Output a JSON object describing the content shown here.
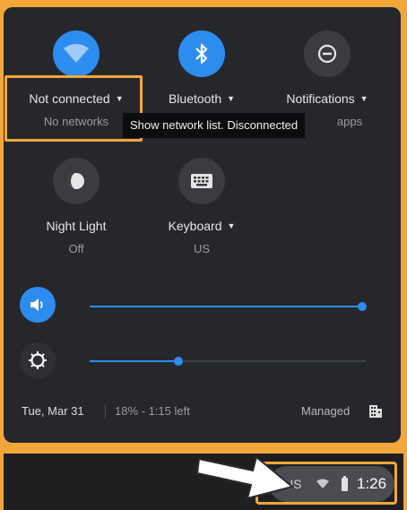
{
  "tiles": [
    {
      "label": "Not connected",
      "sub": "No networks",
      "icon": "wifi-icon",
      "active": true
    },
    {
      "label": "Bluetooth",
      "sub": "",
      "icon": "bluetooth-icon",
      "active": true
    },
    {
      "label": "Notifications",
      "sub": "apps",
      "icon": "do-not-disturb-icon",
      "active": false
    },
    {
      "label": "Night Light",
      "sub": "Off",
      "icon": "night-light-icon",
      "active": false
    },
    {
      "label": "Keyboard",
      "sub": "US",
      "icon": "keyboard-icon",
      "active": false
    }
  ],
  "tooltip": "Show network list. Disconnected",
  "volume": {
    "icon": "volume-icon",
    "level": 1.0
  },
  "brightness": {
    "icon": "brightness-icon",
    "level": 0.32
  },
  "footer": {
    "date": "Tue, Mar 31",
    "battery": "18% - 1:15 left",
    "managed": "Managed",
    "managed_icon": "building-icon"
  },
  "shelf": {
    "ime": "US",
    "time": "1:26",
    "icons": [
      "wifi-status-icon",
      "battery-icon"
    ]
  },
  "colors": {
    "accent": "#2d8cf0",
    "highlight": "#f3a73a",
    "panel": "#25272b"
  }
}
